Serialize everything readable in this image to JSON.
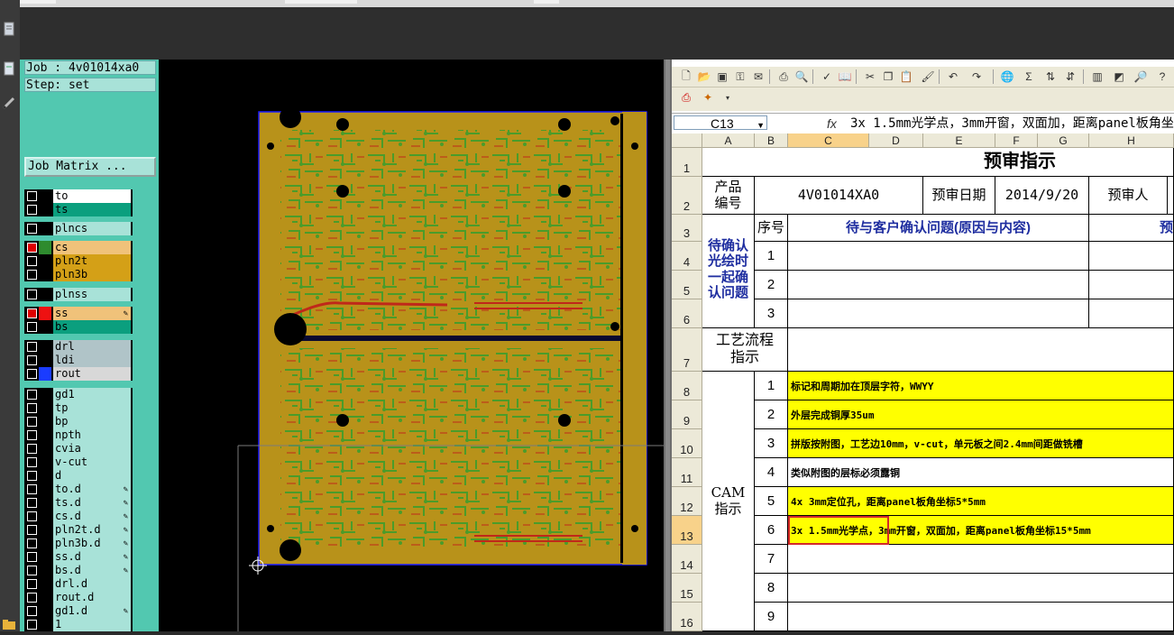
{
  "job_panel": {
    "job_line": "Job : 4v01014xa0",
    "step_line": "Step: set",
    "job_matrix_label": "Job Matrix ..."
  },
  "layers": [
    {
      "name": "to",
      "color": "#ffffff",
      "sw": "#000000",
      "on": false,
      "edit": false
    },
    {
      "name": "ts",
      "color": "#0b9f7e",
      "sw": "#000000",
      "on": false,
      "edit": false
    },
    {
      "name": "plncs",
      "color": "#a8e2d8",
      "sw": "#000000",
      "on": false,
      "edit": false
    },
    {
      "name": "cs",
      "color": "#f0c27a",
      "sw": "#2e8b2e",
      "on": true,
      "edit": false
    },
    {
      "name": "pln2t",
      "color": "#d4a017",
      "sw": "#000000",
      "on": false,
      "edit": false
    },
    {
      "name": "pln3b",
      "color": "#d4a017",
      "sw": "#000000",
      "on": false,
      "edit": false
    },
    {
      "name": "plnss",
      "color": "#a8e2d8",
      "sw": "#000000",
      "on": false,
      "edit": false
    },
    {
      "name": "ss",
      "color": "#f0c27a",
      "sw": "#ee1111",
      "on": true,
      "edit": true
    },
    {
      "name": "bs",
      "color": "#0b9f7e",
      "sw": "#000000",
      "on": false,
      "edit": false
    },
    {
      "name": "drl",
      "color": "#b0c4c8",
      "sw": "#000000",
      "on": false,
      "edit": false
    },
    {
      "name": "ldi",
      "color": "#b0c4c8",
      "sw": "#000000",
      "on": false,
      "edit": false
    },
    {
      "name": "rout",
      "color": "#d8d8d8",
      "sw": "#1a3cff",
      "on": false,
      "edit": false
    },
    {
      "name": "gd1",
      "color": "#a8e2d8",
      "sw": "#000000",
      "on": false,
      "edit": false
    },
    {
      "name": "tp",
      "color": "#a8e2d8",
      "sw": "#000000",
      "on": false,
      "edit": false
    },
    {
      "name": "bp",
      "color": "#a8e2d8",
      "sw": "#000000",
      "on": false,
      "edit": false
    },
    {
      "name": "npth",
      "color": "#a8e2d8",
      "sw": "#000000",
      "on": false,
      "edit": false
    },
    {
      "name": "cvia",
      "color": "#a8e2d8",
      "sw": "#000000",
      "on": false,
      "edit": false
    },
    {
      "name": "v-cut",
      "color": "#a8e2d8",
      "sw": "#000000",
      "on": false,
      "edit": false
    },
    {
      "name": "d",
      "color": "#a8e2d8",
      "sw": "#000000",
      "on": false,
      "edit": false
    },
    {
      "name": "to.d",
      "color": "#a8e2d8",
      "sw": "#000000",
      "on": false,
      "edit": true
    },
    {
      "name": "ts.d",
      "color": "#a8e2d8",
      "sw": "#000000",
      "on": false,
      "edit": true
    },
    {
      "name": "cs.d",
      "color": "#a8e2d8",
      "sw": "#000000",
      "on": false,
      "edit": true
    },
    {
      "name": "pln2t.d",
      "color": "#a8e2d8",
      "sw": "#000000",
      "on": false,
      "edit": true
    },
    {
      "name": "pln3b.d",
      "color": "#a8e2d8",
      "sw": "#000000",
      "on": false,
      "edit": true
    },
    {
      "name": "ss.d",
      "color": "#a8e2d8",
      "sw": "#000000",
      "on": false,
      "edit": true
    },
    {
      "name": "bs.d",
      "color": "#a8e2d8",
      "sw": "#000000",
      "on": false,
      "edit": true
    },
    {
      "name": "drl.d",
      "color": "#a8e2d8",
      "sw": "#000000",
      "on": false,
      "edit": false
    },
    {
      "name": "rout.d",
      "color": "#a8e2d8",
      "sw": "#000000",
      "on": false,
      "edit": false
    },
    {
      "name": "gd1.d",
      "color": "#a8e2d8",
      "sw": "#000000",
      "on": false,
      "edit": true
    },
    {
      "name": "1",
      "color": "#a8e2d8",
      "sw": "#000000",
      "on": false,
      "edit": false
    }
  ],
  "excel": {
    "name_box": "C13",
    "fx": "fx",
    "formula": "3x 1.5mm光学点，3mm开窗，双面加，距离panel板角坐标15*5mm",
    "columns": [
      "A",
      "B",
      "C",
      "D",
      "E",
      "F",
      "G",
      "H"
    ],
    "rows": [
      "1",
      "2",
      "3",
      "4",
      "5",
      "6",
      "7",
      "8",
      "9",
      "10",
      "11",
      "12",
      "13",
      "14",
      "15",
      "16"
    ],
    "title": "预审指示",
    "product_no_label": "产品\n编号",
    "product_no": "4V01014XA0",
    "review_date_label": "预审日期",
    "review_date": "2014/9/20",
    "reviewer_label": "预审人",
    "seq_label": "序号",
    "confirm_header": "待与客户确认问题(原因与内容)",
    "h_cut": "预",
    "left_block": "待确认\n光绘时\n一起确\n认问题",
    "confirm_nums": [
      "1",
      "2",
      "3"
    ],
    "process_label": "工艺流程\n指示",
    "cam_label": "CAM\n指示",
    "cam_nums": [
      "1",
      "2",
      "3",
      "4",
      "5",
      "6",
      "7",
      "8",
      "9"
    ],
    "cam_items": [
      "标记和周期加在顶层字符，WWYY",
      "外层完成铜厚35um",
      "拼版按附图，工艺边10mm，v-cut，单元板之间2.4mm间距做铣槽",
      "类似附图的层标必须露铜",
      "4x  3mm定位孔，距离panel板角坐标5*5mm",
      "3x  1.5mm光学点，3mm开窗，双面加，距离panel板角坐标15*5mm",
      "",
      "",
      ""
    ],
    "cam_yellow": [
      true,
      true,
      true,
      false,
      true,
      true,
      false,
      false,
      false
    ]
  },
  "icons": [
    "document-icon",
    "page-icon",
    "pencil-icon",
    "new-file-icon",
    "open-folder-icon",
    "save-icon",
    "print-icon",
    "print-preview-icon",
    "spellcheck-icon",
    "research-icon",
    "cut-icon",
    "copy-icon",
    "paste-icon",
    "format-painter-icon",
    "undo-icon",
    "redo-icon",
    "hyperlink-icon",
    "autosum-icon",
    "sort-asc-icon",
    "sort-desc-icon",
    "chart-icon",
    "pdf-icon",
    "pdf-convert-icon"
  ]
}
